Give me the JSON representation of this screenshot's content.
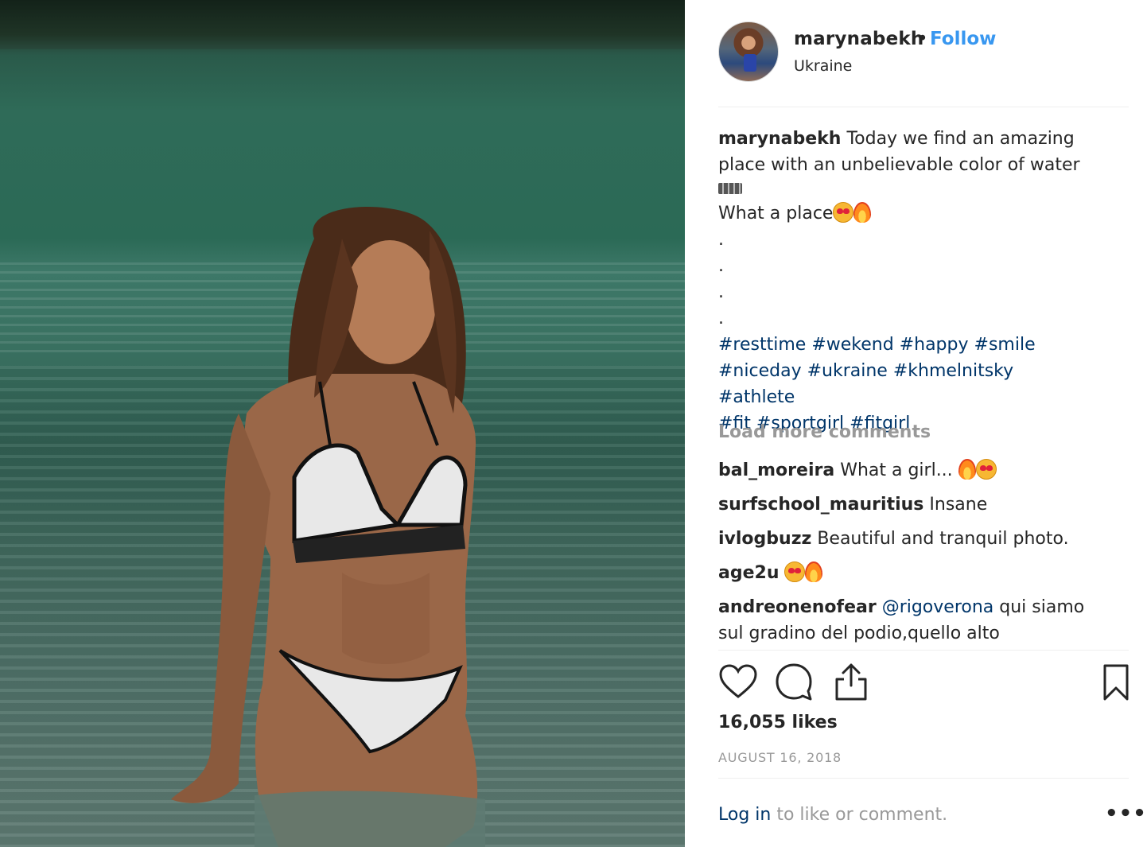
{
  "post": {
    "image_alt": "",
    "username": "marynabekh",
    "dot": "•",
    "follow_label": "Follow",
    "location": "Ukraine"
  },
  "caption": {
    "username": "marynabekh",
    "text_line1": "Today we find an amazing",
    "text_line2": "place with an unbelievable color of water",
    "text_line3": "What a place",
    "dots": [
      ".",
      ".",
      ".",
      "."
    ],
    "hashtags_line1": [
      "#resttime",
      "#wekend",
      "#happy",
      "#smile"
    ],
    "hashtags_line2": [
      "#niceday",
      "#ukraine",
      "#khmelnitsky",
      "#athlete"
    ],
    "hashtags_line3": [
      "#fit",
      "#sportgirl",
      "#fitgirl"
    ]
  },
  "load_more_label": "Load more comments",
  "comments": [
    {
      "user": "bal_moreira",
      "text": "What a girl... ",
      "emojis": [
        "fire",
        "heart-eyes"
      ]
    },
    {
      "user": "surfschool_mauritius",
      "text": "Insane",
      "emojis": []
    },
    {
      "user": "ivlogbuzz",
      "text": "Beautiful and tranquil photo.",
      "emojis": []
    },
    {
      "user": "age2u",
      "text": " ",
      "emojis": [
        "heart-eyes",
        "fire"
      ]
    },
    {
      "user": "andreonenofear",
      "mention": "@rigoverona",
      "text": " qui siamo",
      "text2": "sul gradino del podio,quello alto",
      "emojis": []
    }
  ],
  "likes": "16,055 likes",
  "date": "AUGUST 16, 2018",
  "login": {
    "link": "Log in",
    "rest": " to like or comment."
  },
  "more_label": "•••",
  "icons": {
    "like": "heart-icon",
    "comment": "comment-bubble-icon",
    "share": "share-upload-icon",
    "save": "bookmark-icon"
  },
  "colors": {
    "link_blue": "#3897f0",
    "hashtag": "#003569",
    "muted": "#999999",
    "text": "#262626"
  }
}
